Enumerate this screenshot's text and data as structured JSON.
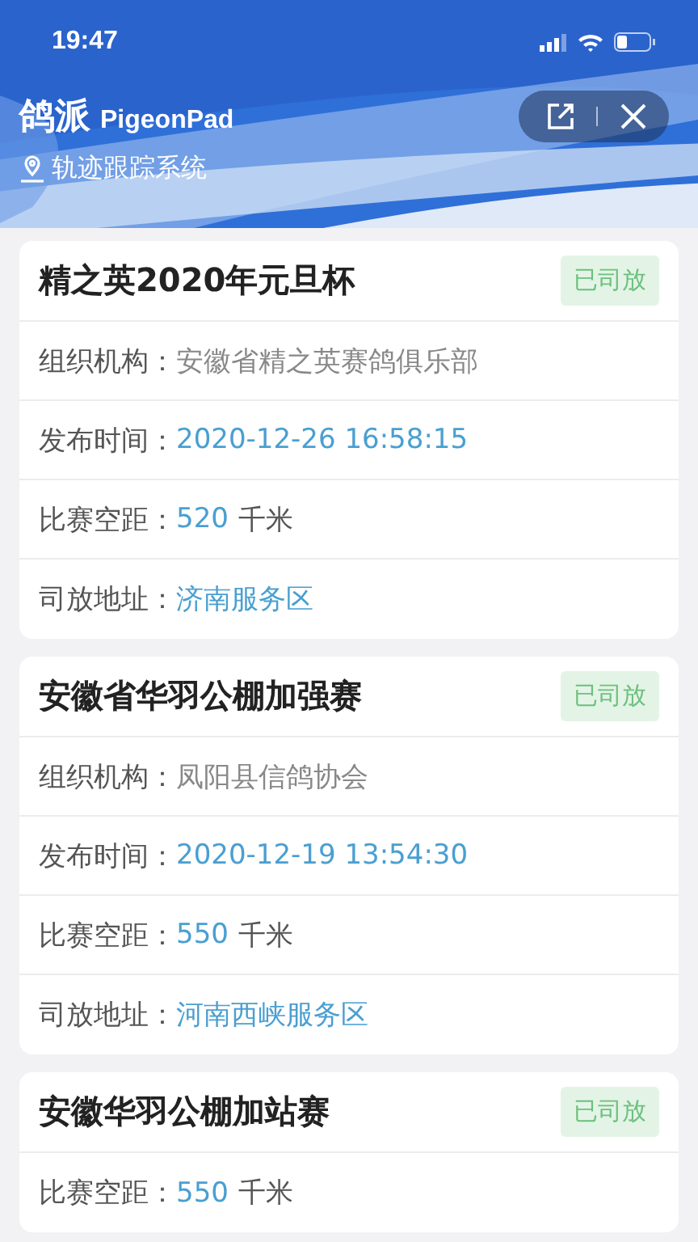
{
  "status_bar": {
    "time": "19:47"
  },
  "header": {
    "app_name": "鸽派",
    "app_name_latin": "PigeonPad",
    "subtitle": "轨迹跟踪系统"
  },
  "races": [
    {
      "title": "精之英2020年元旦杯",
      "status": "已司放",
      "fields": [
        {
          "kind": "plain",
          "label": "组织机构：",
          "value": "安徽省精之英赛鸽俱乐部"
        },
        {
          "kind": "highlight",
          "label": "发布时间：",
          "value": "2020-12-26 16:58:15"
        },
        {
          "kind": "distance",
          "label": "比赛空距：",
          "value": "520",
          "unit": "千米"
        },
        {
          "kind": "highlight",
          "label": "司放地址：",
          "value": "济南服务区"
        }
      ]
    },
    {
      "title": "安徽省华羽公棚加强赛",
      "status": "已司放",
      "fields": [
        {
          "kind": "plain",
          "label": "组织机构：",
          "value": "凤阳县信鸽协会"
        },
        {
          "kind": "highlight",
          "label": "发布时间：",
          "value": "2020-12-19 13:54:30"
        },
        {
          "kind": "distance",
          "label": "比赛空距：",
          "value": "550",
          "unit": "千米"
        },
        {
          "kind": "highlight",
          "label": "司放地址：",
          "value": "河南西峡服务区"
        }
      ]
    },
    {
      "title": "安徽华羽公棚加站赛",
      "status": "已司放",
      "fields": [
        {
          "kind": "distance",
          "label": "比赛空距：",
          "value": "550",
          "unit": "千米"
        }
      ]
    }
  ]
}
